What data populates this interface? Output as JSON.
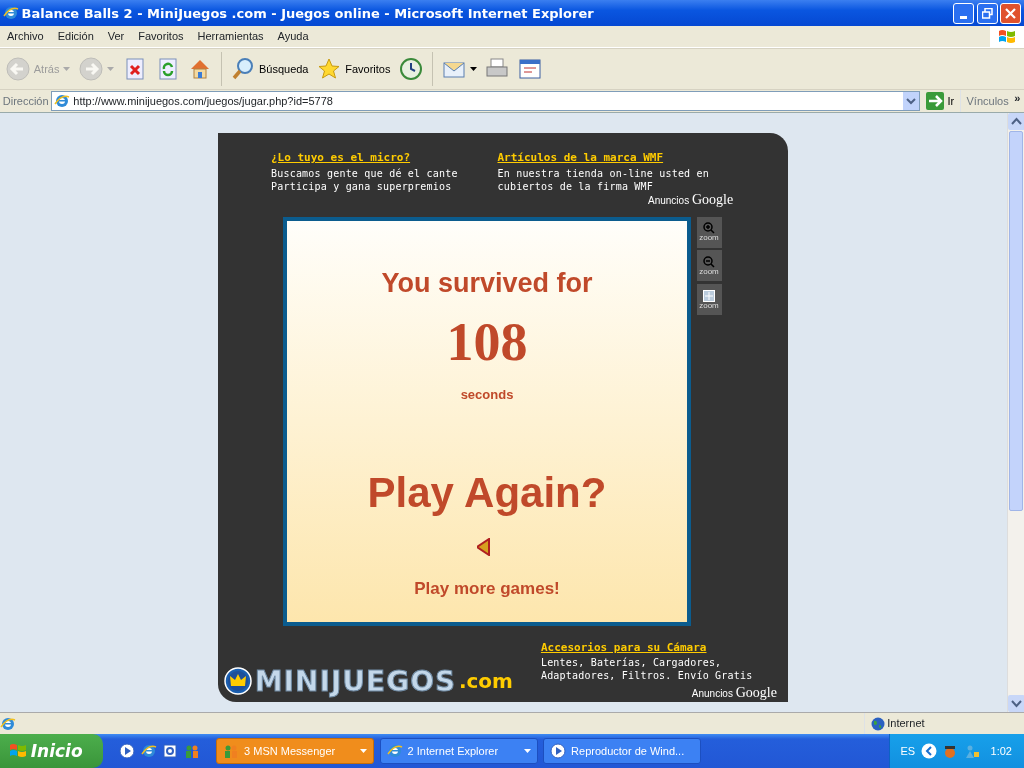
{
  "window": {
    "title": "Balance Balls 2 - MiniJuegos .com - Juegos online - Microsoft Internet Explorer"
  },
  "menu": [
    "Archivo",
    "Edición",
    "Ver",
    "Favoritos",
    "Herramientas",
    "Ayuda"
  ],
  "toolbar": [
    {
      "kind": "back",
      "label": "Atrás",
      "disabled": true,
      "dropdown": true
    },
    {
      "kind": "forward",
      "disabled": true,
      "dropdown": true
    },
    {
      "kind": "stop",
      "disabled": false
    },
    {
      "kind": "refresh",
      "disabled": false
    },
    {
      "kind": "home",
      "disabled": false
    },
    {
      "kind": "search",
      "label": "Búsqueda",
      "disabled": false,
      "separator_before": true
    },
    {
      "kind": "favorites",
      "label": "Favoritos",
      "disabled": false
    },
    {
      "kind": "history",
      "disabled": false
    },
    {
      "kind": "mail",
      "disabled": false,
      "dropdown": true,
      "separator_before": true
    },
    {
      "kind": "print",
      "disabled": false
    },
    {
      "kind": "edit",
      "disabled": false
    }
  ],
  "address_bar": {
    "label": "Dirección",
    "value": "http://www.minijuegos.com/juegos/jugar.php?id=5778",
    "go": "Ir",
    "links": "Vínculos",
    "more": "»"
  },
  "page": {
    "top_ads": [
      {
        "title": "¿Lo tuyo es el micro?",
        "lines": [
          "Buscamos gente que dé el cante",
          "Participa y gana superpremios"
        ]
      },
      {
        "title": "Artículos de la marca WMF",
        "lines": [
          "En nuestra tienda on-line usted en",
          "cubiertos de la firma WMF"
        ]
      }
    ],
    "top_ads_label": {
      "prefix": "Anuncios",
      "brand": "Google"
    },
    "game": {
      "heading": "You survived for",
      "score": "108",
      "unit": "seconds",
      "play_again": "Play Again?",
      "more_games": "Play more games!"
    },
    "zoom_controls": [
      {
        "kind": "zoom-in",
        "label": "zoom"
      },
      {
        "kind": "zoom-out",
        "label": "zoom"
      },
      {
        "kind": "fit",
        "label": "zoom"
      }
    ],
    "logo": {
      "name": "MINIJUEGOS",
      "suffix": ".com"
    },
    "bottom_ad": {
      "title": "Accesorios para su Cámara",
      "lines": [
        "Lentes, Baterías, Cargadores,",
        "Adaptadores, Filtros. Envío Gratis"
      ]
    },
    "bottom_ads_label": {
      "prefix": "Anuncios",
      "brand": "Google"
    }
  },
  "status_bar": {
    "zone": "Internet"
  },
  "taskbar": {
    "start": "Inicio",
    "tasks": [
      {
        "count": "3",
        "label": "MSN Messenger",
        "flashing": true
      },
      {
        "count": "2",
        "label": "Internet Explorer",
        "flashing": false
      },
      {
        "label": "Reproductor de Wind...",
        "flashing": false
      }
    ],
    "language": "ES",
    "clock": "1:02"
  }
}
